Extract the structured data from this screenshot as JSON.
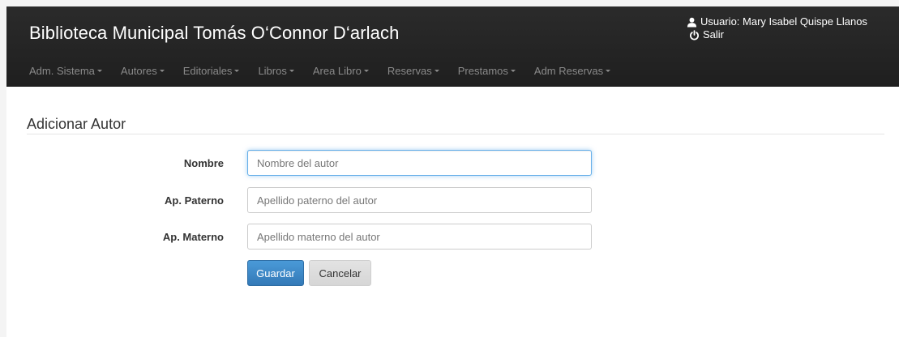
{
  "app": {
    "title": "Biblioteca Municipal Tomás O‘Connor D‘arlach"
  },
  "user": {
    "label": "Usuario: Mary Isabel Quispe Llanos",
    "logout_label": "Salir",
    "user_icon": "user-icon",
    "logout_icon": "power-icon"
  },
  "nav": {
    "items": [
      {
        "label": "Adm. Sistema"
      },
      {
        "label": "Autores"
      },
      {
        "label": "Editoriales"
      },
      {
        "label": "Libros"
      },
      {
        "label": "Area Libro"
      },
      {
        "label": "Reservas"
      },
      {
        "label": "Prestamos"
      },
      {
        "label": "Adm Reservas"
      }
    ]
  },
  "form": {
    "title": "Adicionar Autor",
    "fields": [
      {
        "label": "Nombre",
        "placeholder": "Nombre del autor",
        "value": ""
      },
      {
        "label": "Ap. Paterno",
        "placeholder": "Apellido paterno del autor",
        "value": ""
      },
      {
        "label": "Ap. Materno",
        "placeholder": "Apellido materno del autor",
        "value": ""
      }
    ],
    "save_label": "Guardar",
    "cancel_label": "Cancelar"
  },
  "colors": {
    "header_bg": "#222222",
    "nav_text": "#8a8a8a",
    "primary_button": "#428bca",
    "focus_border": "#66afe9"
  }
}
